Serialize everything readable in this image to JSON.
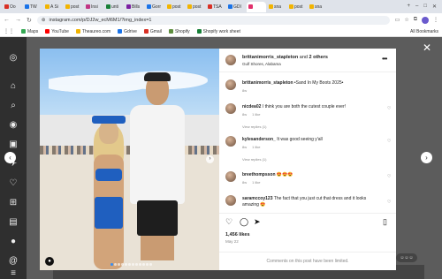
{
  "browser": {
    "tabs": [
      {
        "label": "Oo",
        "color": "#d93025",
        "active": false
      },
      {
        "label": "TW",
        "color": "#1a73e8",
        "active": false
      },
      {
        "label": "A Si",
        "color": "#f2b400",
        "active": false
      },
      {
        "label": "post",
        "color": "#f2b400",
        "active": false
      },
      {
        "label": "Insi",
        "color": "#c13584",
        "active": false
      },
      {
        "label": "unti",
        "color": "#188038",
        "active": false
      },
      {
        "label": "Bills",
        "color": "#7b1fa2",
        "active": false
      },
      {
        "label": "Gorr",
        "color": "#1a73e8",
        "active": false
      },
      {
        "label": "post",
        "color": "#f2b400",
        "active": false
      },
      {
        "label": "post",
        "color": "#f2b400",
        "active": false
      },
      {
        "label": "TSA",
        "color": "#d93025",
        "active": false
      },
      {
        "label": "GDI",
        "color": "#1a73e8",
        "active": false
      },
      {
        "label": "",
        "color": "#e1306c",
        "active": true
      },
      {
        "label": "sna",
        "color": "#f2b400",
        "active": false
      },
      {
        "label": "post",
        "color": "#f2b400",
        "active": false
      },
      {
        "label": "sna",
        "color": "#f2b400",
        "active": false
      }
    ],
    "url": "instagram.com/p/DJ2w_ecM6M1/?img_index=1",
    "bookmarks": [
      {
        "label": "Maps",
        "color": "#34a853"
      },
      {
        "label": "YouTube",
        "color": "#ff0000"
      },
      {
        "label": "Theaureo.com",
        "color": "#f2b400"
      },
      {
        "label": "Gdrive",
        "color": "#1a73e8"
      },
      {
        "label": "Gmail",
        "color": "#d93025"
      },
      {
        "label": "Shopify",
        "color": "#5e8e3e"
      },
      {
        "label": "Shopify work sheet",
        "color": "#188038"
      }
    ],
    "all_bookmarks": "All Bookmarks"
  },
  "post": {
    "header": {
      "username": "brittanimorris_stapleton",
      "and": "and",
      "others": "2 others",
      "location": "Gulf Shores, Alabama",
      "more_icon": "more-horizontal-icon"
    },
    "comments": [
      {
        "user": "brittanimorris_stapleton",
        "text": "•Sand In My Boots 2025•",
        "time": "8w",
        "likes": "",
        "replies": ""
      },
      {
        "user": "nicdea02",
        "text": "I think you are both the cutest couple ever!",
        "time": "8w",
        "likes": "1 like",
        "replies": "View replies (1)"
      },
      {
        "user": "kylesanderson_",
        "text": "It was good seeing y'all",
        "time": "8w",
        "likes": "1 like",
        "replies": "View replies (1)"
      },
      {
        "user": "breethompsson",
        "text": "😍😍😍",
        "time": "8w",
        "likes": "1 like",
        "replies": ""
      },
      {
        "user": "saramccoy123",
        "text": "The fact that you just cut that dress and it looks amazing 😍",
        "time": "8w",
        "likes": "",
        "replies": ""
      }
    ],
    "likes": "1,456 likes",
    "date": "May 22",
    "comments_limited": "Comments on this post have been limited."
  },
  "colors": {
    "accent": "#3a8ef0",
    "backdrop": "#5c5c5c"
  }
}
